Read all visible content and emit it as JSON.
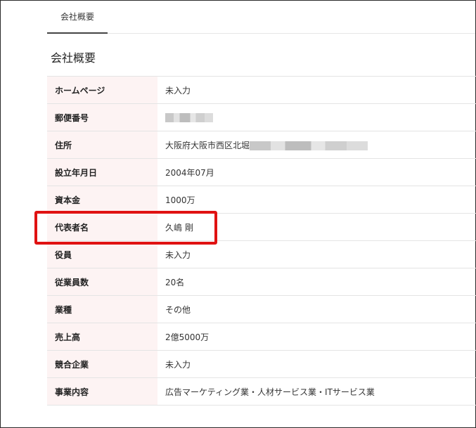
{
  "tabs": [
    {
      "label": "会社概要"
    }
  ],
  "section_title": "会社概要",
  "rows": [
    {
      "label": "ホームページ",
      "value": "未入力"
    },
    {
      "label": "郵便番号",
      "value": ""
    },
    {
      "label": "住所",
      "value": "大阪府大阪市西区北堀"
    },
    {
      "label": "設立年月日",
      "value": "2004年07月"
    },
    {
      "label": "資本金",
      "value": "1000万"
    },
    {
      "label": "代表者名",
      "value": "久嶋 剛"
    },
    {
      "label": "役員",
      "value": "未入力"
    },
    {
      "label": "従業員数",
      "value": "20名"
    },
    {
      "label": "業種",
      "value": "その他"
    },
    {
      "label": "売上高",
      "value": "2億5000万"
    },
    {
      "label": "競合企業",
      "value": "未入力"
    },
    {
      "label": "事業内容",
      "value": "広告マーケティング業・人材サービス業・ITサービス業"
    }
  ],
  "colors": {
    "label_bg": "#fdf3f3",
    "highlight": "#e01212",
    "border": "#e4e4e4"
  }
}
